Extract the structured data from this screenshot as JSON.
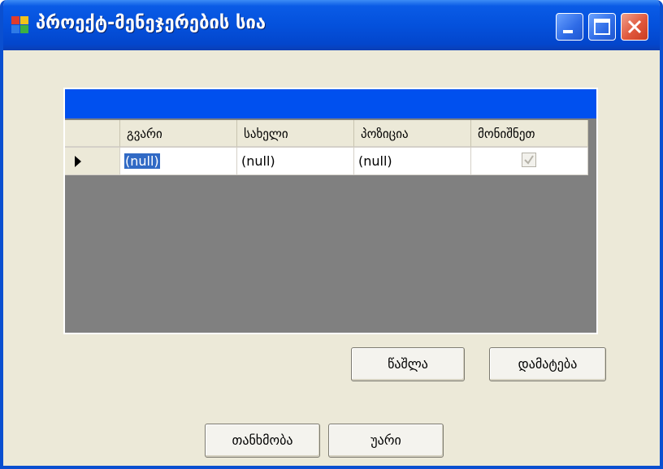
{
  "window": {
    "title": "პროექტ-მენეჯერების სია"
  },
  "titlebar_buttons": {
    "minimize": "minimize-icon",
    "maximize": "maximize-icon",
    "close": "close-icon"
  },
  "grid": {
    "columns": [
      "გვარი",
      "სახელი",
      "პოზიცია",
      "მონიშნეთ"
    ],
    "rows": [
      {
        "surname": "(null)",
        "name": "(null)",
        "position": "(null)",
        "checked": true
      }
    ],
    "row_indicator_icon": "current-row-arrow-icon"
  },
  "actions": {
    "delete_label": "წაშლა",
    "add_label": "დამატება",
    "ok_label": "თანხმობა",
    "cancel_label": "უარი"
  },
  "colors": {
    "titlebar": "#0451DC",
    "window_bg": "#ECE9D8",
    "grid_caption": "#0050EF",
    "grid_bg": "#808080",
    "selection": "#316AC5",
    "close_button": "#E0583C"
  }
}
